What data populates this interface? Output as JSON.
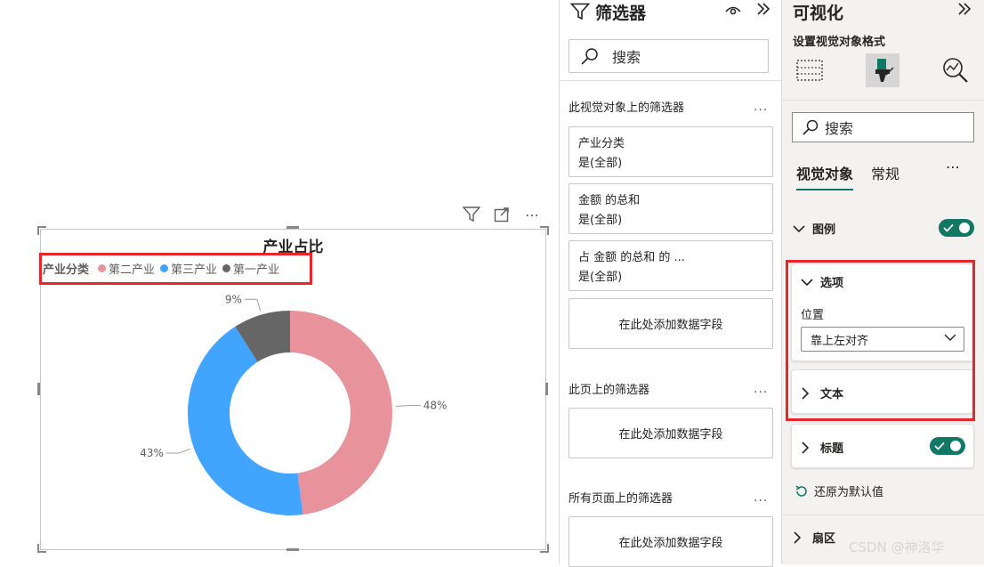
{
  "visual": {
    "title": "产业占比",
    "legend": {
      "title": "产业分类",
      "items": [
        {
          "label": "第二产业",
          "color": "#e8929b"
        },
        {
          "label": "第三产业",
          "color": "#41a4ff"
        },
        {
          "label": "第一产业",
          "color": "#666666"
        }
      ]
    },
    "toolbar": {
      "filter_icon": "filter-icon",
      "focus_icon": "focus-mode-icon",
      "more_label": "⋯"
    }
  },
  "chart_data": {
    "type": "pie",
    "variant": "donut",
    "title": "产业占比",
    "legend_title": "产业分类",
    "legend_position": "top-left",
    "categories": [
      "第二产业",
      "第三产业",
      "第一产业"
    ],
    "values": [
      48,
      43,
      9
    ],
    "labels": [
      "48%",
      "43%",
      "9%"
    ],
    "colors": [
      "#e8929b",
      "#41a4ff",
      "#666666"
    ]
  },
  "filter_pane": {
    "title": "筛选器",
    "search_placeholder": "搜索",
    "visual_section": {
      "label": "此视觉对象上的筛选器",
      "more": "...",
      "cards": [
        {
          "name": "产业分类",
          "state": "是(全部)"
        },
        {
          "name": "金额 的总和",
          "state": "是(全部)"
        },
        {
          "name": "占 金额 的总和 的 ...",
          "state": "是(全部)"
        }
      ],
      "drop_label": "在此处添加数据字段"
    },
    "page_section": {
      "label": "此页上的筛选器",
      "more": "...",
      "drop_label": "在此处添加数据字段"
    },
    "all_pages_section": {
      "label": "所有页面上的筛选器",
      "more": "...",
      "drop_label": "在此处添加数据字段"
    }
  },
  "viz_pane": {
    "title": "可视化",
    "subtitle": "设置视觉对象格式",
    "search_placeholder": "搜索",
    "tabs": [
      {
        "label": "视觉对象",
        "active": true
      },
      {
        "label": "常规",
        "active": false
      }
    ],
    "more": "⋯",
    "legend_section": {
      "label": "图例",
      "on": true
    },
    "options_section": {
      "label": "选项",
      "position_label": "位置",
      "position_value": "靠上左对齐"
    },
    "text_section": {
      "label": "文本"
    },
    "title_section": {
      "label": "标题",
      "on": true
    },
    "reset_label": "还原为默认值",
    "slices_section": {
      "label": "扇区"
    }
  },
  "watermark": "CSDN @神洛华"
}
